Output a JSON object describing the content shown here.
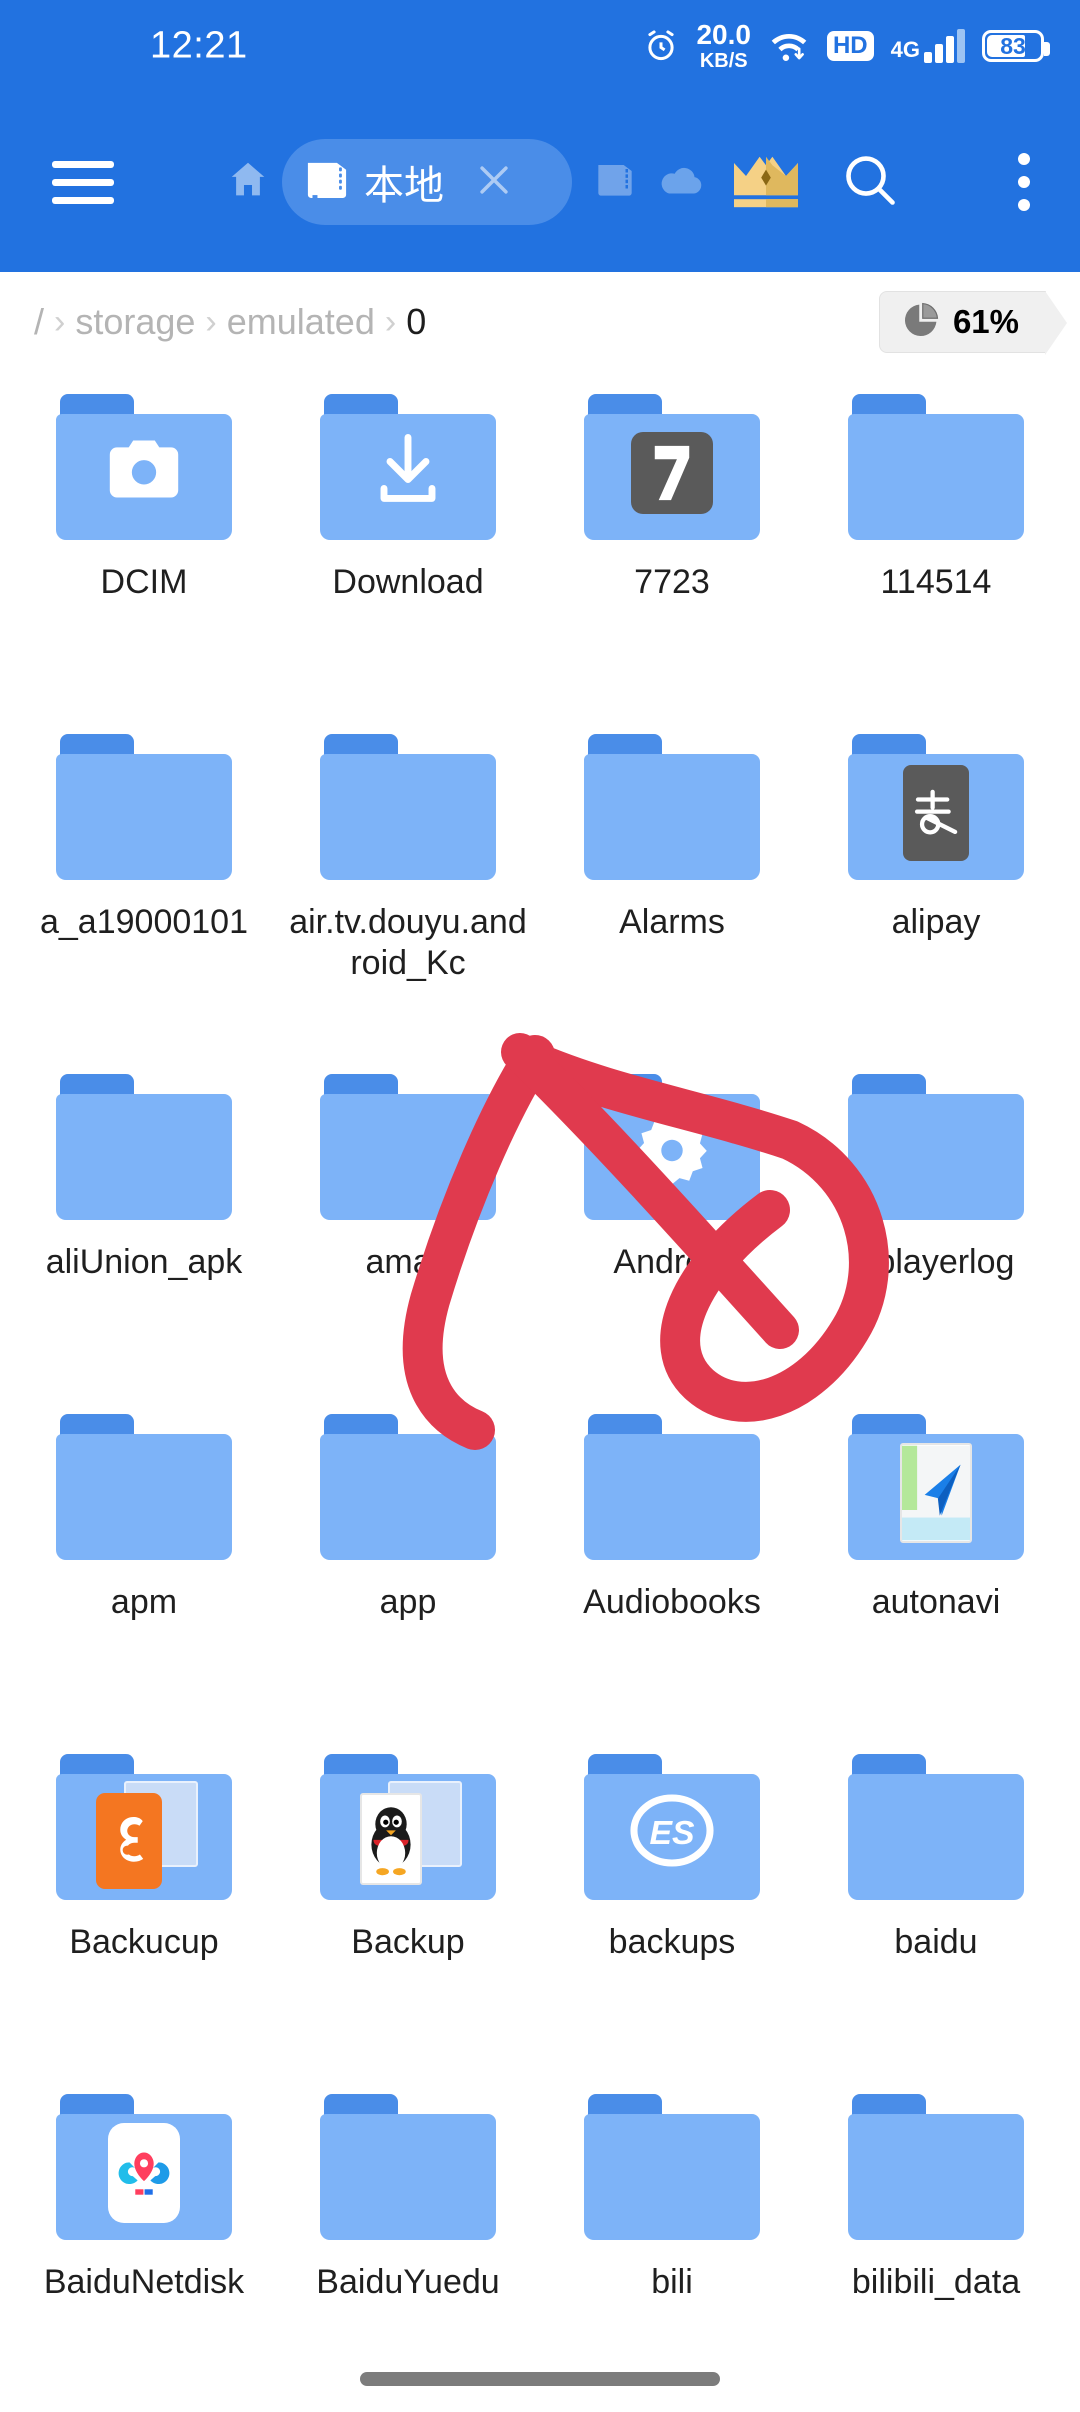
{
  "status_bar": {
    "clock": "12:21",
    "alarm_icon": "alarm-clock-icon",
    "net_speed_value": "20.0",
    "net_speed_unit": "KB/S",
    "wifi_icon": "wifi-icon",
    "hd_badge": "HD",
    "network_type": "4G",
    "battery_level": "83"
  },
  "toolbar": {
    "menu_icon": "hamburger-menu-icon",
    "home_icon": "home-icon",
    "active_tab": {
      "label": "本地",
      "icon": "sdcard-icon",
      "close_icon": "close-icon"
    },
    "second_tab_icon": "sdcard-icon",
    "cloud_icon": "cloud-icon",
    "vip_icon": "crown-icon",
    "search_icon": "search-icon",
    "more_icon": "overflow-menu-icon",
    "accent_color": "#2272E0",
    "tab_active_color": "#4A8DE8"
  },
  "breadcrumb": {
    "segments": [
      "/",
      "storage",
      "emulated",
      "0"
    ],
    "separator": "›",
    "storage_percent": "61%",
    "storage_icon": "pie-chart-icon"
  },
  "files": [
    {
      "name": "DCIM",
      "emblem": "camera-icon"
    },
    {
      "name": "Download",
      "emblem": "download-icon"
    },
    {
      "name": "7723",
      "emblem": "7723-app-icon"
    },
    {
      "name": "114514",
      "emblem": null
    },
    {
      "name": "a_a19000101",
      "emblem": null
    },
    {
      "name": "air.tv.douyu.android_Kc",
      "emblem": null
    },
    {
      "name": "Alarms",
      "emblem": null
    },
    {
      "name": "alipay",
      "emblem": "alipay-icon"
    },
    {
      "name": "aliUnion_apk",
      "emblem": null
    },
    {
      "name": "amap",
      "emblem": null
    },
    {
      "name": "Android",
      "emblem": "gear-icon"
    },
    {
      "name": "aplayerlog",
      "emblem": null
    },
    {
      "name": "apm",
      "emblem": null
    },
    {
      "name": "app",
      "emblem": null
    },
    {
      "name": "Audiobooks",
      "emblem": null
    },
    {
      "name": "autonavi",
      "emblem": "autonavi-icon"
    },
    {
      "name": "Backucup",
      "emblem": "uc-browser-icon"
    },
    {
      "name": "Backup",
      "emblem": "qq-penguin-icon"
    },
    {
      "name": "backups",
      "emblem": "es-explorer-icon"
    },
    {
      "name": "baidu",
      "emblem": null
    },
    {
      "name": "BaiduNetdisk",
      "emblem": "baidu-netdisk-icon"
    },
    {
      "name": "BaiduYuedu",
      "emblem": null
    },
    {
      "name": "bili",
      "emblem": null
    },
    {
      "name": "bilibili_data",
      "emblem": null
    }
  ],
  "annotation": {
    "type": "hand-drawn-red-circle-and-slash",
    "color": "#E03A4E",
    "targets": "Android"
  },
  "nav_bar": {
    "gesture_pill": "home-gesture-pill"
  },
  "colors": {
    "header_blue": "#2272E0",
    "folder_body": "#7DB3F8",
    "folder_tab": "#4A8DE8",
    "annotation_red": "#E03A4E",
    "text_primary": "#1f1f1f",
    "text_muted": "#b4b4b4"
  }
}
